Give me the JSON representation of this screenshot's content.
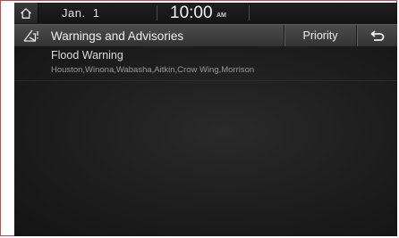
{
  "status_bar": {
    "home_icon": "home-icon",
    "date": "Jan.  1",
    "time": "10:00",
    "ampm": "AM"
  },
  "title_bar": {
    "icon": "warning-advisory-icon",
    "title": "Warnings and Advisories",
    "priority_label": "Priority",
    "back_icon": "back-arrow-icon"
  },
  "warnings": [
    {
      "title": "Flood Warning",
      "areas": "Houston,Winona,Wabasha,Aitkin,Crow Wing,Morrison"
    }
  ],
  "colors": {
    "frame_border": "#d6404a",
    "background": "#191919",
    "title_bar": "#404040"
  }
}
